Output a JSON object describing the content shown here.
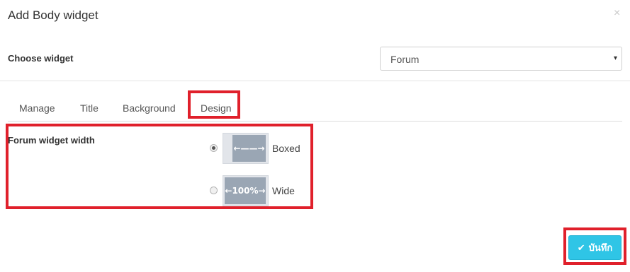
{
  "modal": {
    "title": "Add Body widget",
    "close_glyph": "×"
  },
  "choose_widget": {
    "label": "Choose widget",
    "selected": "Forum",
    "caret_glyph": "▾"
  },
  "tabs": [
    {
      "label": "Manage",
      "active": false
    },
    {
      "label": "Title",
      "active": false
    },
    {
      "label": "Background",
      "active": false
    },
    {
      "label": "Design",
      "active": true
    }
  ],
  "design": {
    "width_label": "Forum widget width",
    "options": [
      {
        "label": "Boxed",
        "thumb_text": "←——→",
        "selected": true,
        "icon": "boxed-width-icon"
      },
      {
        "label": "Wide",
        "thumb_text": "←100%→",
        "selected": false,
        "icon": "wide-width-icon"
      }
    ]
  },
  "footer": {
    "save_label": "บันทึก",
    "save_icon": "check-icon",
    "check_glyph": "✔"
  },
  "colors": {
    "highlight": "#e0202b",
    "save_button": "#2fc5e6",
    "thumb_fill": "#9aa6b4"
  }
}
